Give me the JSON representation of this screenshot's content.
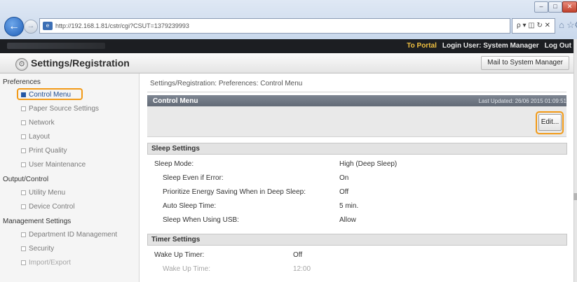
{
  "browser": {
    "url": "http://192.168.1.81/cstr/cgi?CSUT=1379239993",
    "window_controls": {
      "minimize": "–",
      "maximize": "□",
      "close": "✕"
    },
    "address_tools": "ρ ▾ ◫ ↻ ✕",
    "icons": {
      "back": "back-arrow-icon",
      "forward": "forward-arrow-icon",
      "home": "home-icon",
      "star": "star-icon",
      "gear": "gear-icon"
    }
  },
  "top_bar": {
    "portal_link": "To Portal",
    "login_user": "Login User: System Manager",
    "logout_link": "Log Out"
  },
  "header": {
    "title": "Settings/Registration",
    "mail_button": "Mail to System Manager"
  },
  "sidebar": {
    "groups": [
      {
        "title": "Preferences",
        "items": [
          "Control Menu",
          "Paper Source Settings",
          "Network",
          "Layout",
          "Print Quality",
          "User Maintenance"
        ]
      },
      {
        "title": "Output/Control",
        "items": [
          "Utility Menu",
          "Device Control"
        ]
      },
      {
        "title": "Management Settings",
        "items": [
          "Department ID Management",
          "Security",
          "Import/Export"
        ]
      }
    ],
    "active_item": "Control Menu"
  },
  "main": {
    "breadcrumb": "Settings/Registration: Preferences: Control Menu",
    "panel_title": "Control Menu",
    "last_updated": "Last Updated: 26/06 2015 01:09:51",
    "edit_button": "Edit...",
    "sleep_settings": {
      "title": "Sleep Settings",
      "rows": [
        {
          "label": "Sleep Mode:",
          "value": "High (Deep Sleep)"
        },
        {
          "label": "Sleep Even if Error:",
          "value": "On"
        },
        {
          "label": "Prioritize Energy Saving When in Deep Sleep:",
          "value": "Off"
        },
        {
          "label": "Auto Sleep Time:",
          "value": "5 min."
        },
        {
          "label": "Sleep When Using USB:",
          "value": "Allow"
        }
      ]
    },
    "timer_settings": {
      "title": "Timer Settings",
      "rows": [
        {
          "label": "Wake Up Timer:",
          "value": "Off"
        },
        {
          "label": "Wake Up Time:",
          "value": "12:00"
        }
      ]
    }
  },
  "colors": {
    "accent_highlight": "#f29a17",
    "panel_header": "#6b7380",
    "top_bar": "#1c1e22",
    "link_yellow": "#f0c040"
  }
}
